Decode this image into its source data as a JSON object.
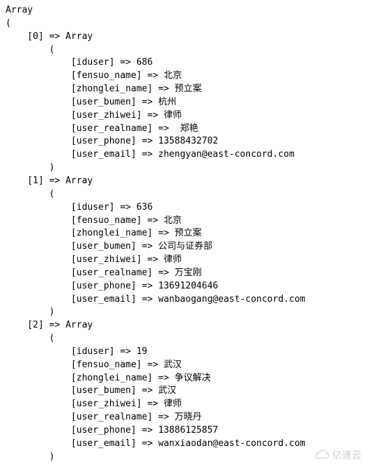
{
  "header": "Array",
  "open": "(",
  "close": ")",
  "item_type": "Array",
  "arrow": " => ",
  "items": [
    {
      "index": "0",
      "fields": [
        {
          "key": "iduser",
          "value": "686"
        },
        {
          "key": "fensuo_name",
          "value": "北京"
        },
        {
          "key": "zhonglei_name",
          "value": "预立案"
        },
        {
          "key": "user_bumen",
          "value": "杭州"
        },
        {
          "key": "user_zhiwei",
          "value": "律师"
        },
        {
          "key": "user_realname",
          "value": " 郑艳"
        },
        {
          "key": "user_phone",
          "value": "13588432702"
        },
        {
          "key": "user_email",
          "value": "zhengyan@east-concord.com"
        }
      ]
    },
    {
      "index": "1",
      "fields": [
        {
          "key": "iduser",
          "value": "636"
        },
        {
          "key": "fensuo_name",
          "value": "北京"
        },
        {
          "key": "zhonglei_name",
          "value": "预立案"
        },
        {
          "key": "user_bumen",
          "value": "公司与证券部"
        },
        {
          "key": "user_zhiwei",
          "value": "律师"
        },
        {
          "key": "user_realname",
          "value": "万宝刚"
        },
        {
          "key": "user_phone",
          "value": "13691204646"
        },
        {
          "key": "user_email",
          "value": "wanbaogang@east-concord.com"
        }
      ]
    },
    {
      "index": "2",
      "fields": [
        {
          "key": "iduser",
          "value": "19"
        },
        {
          "key": "fensuo_name",
          "value": "武汉"
        },
        {
          "key": "zhonglei_name",
          "value": "争议解决"
        },
        {
          "key": "user_bumen",
          "value": "武汉"
        },
        {
          "key": "user_zhiwei",
          "value": "律师"
        },
        {
          "key": "user_realname",
          "value": "万晓丹"
        },
        {
          "key": "user_phone",
          "value": "13886125857"
        },
        {
          "key": "user_email",
          "value": "wanxiaodan@east-concord.com"
        }
      ]
    }
  ],
  "watermark_text": "亿速云"
}
